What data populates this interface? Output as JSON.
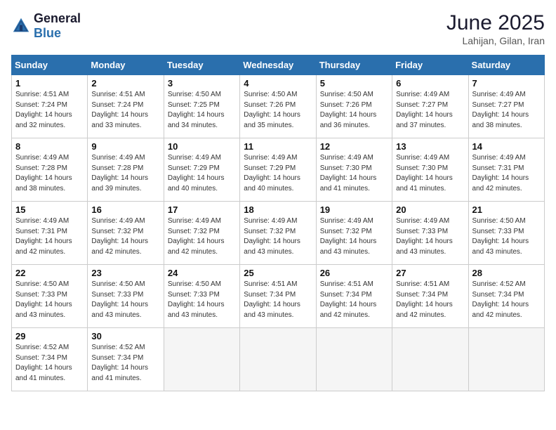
{
  "header": {
    "logo_general": "General",
    "logo_blue": "Blue",
    "title": "June 2025",
    "subtitle": "Lahijan, Gilan, Iran"
  },
  "weekdays": [
    "Sunday",
    "Monday",
    "Tuesday",
    "Wednesday",
    "Thursday",
    "Friday",
    "Saturday"
  ],
  "weeks": [
    [
      {
        "day": 1,
        "sunrise": "4:51 AM",
        "sunset": "7:24 PM",
        "daylight": "14 hours and 32 minutes."
      },
      {
        "day": 2,
        "sunrise": "4:51 AM",
        "sunset": "7:24 PM",
        "daylight": "14 hours and 33 minutes."
      },
      {
        "day": 3,
        "sunrise": "4:50 AM",
        "sunset": "7:25 PM",
        "daylight": "14 hours and 34 minutes."
      },
      {
        "day": 4,
        "sunrise": "4:50 AM",
        "sunset": "7:26 PM",
        "daylight": "14 hours and 35 minutes."
      },
      {
        "day": 5,
        "sunrise": "4:50 AM",
        "sunset": "7:26 PM",
        "daylight": "14 hours and 36 minutes."
      },
      {
        "day": 6,
        "sunrise": "4:49 AM",
        "sunset": "7:27 PM",
        "daylight": "14 hours and 37 minutes."
      },
      {
        "day": 7,
        "sunrise": "4:49 AM",
        "sunset": "7:27 PM",
        "daylight": "14 hours and 38 minutes."
      }
    ],
    [
      {
        "day": 8,
        "sunrise": "4:49 AM",
        "sunset": "7:28 PM",
        "daylight": "14 hours and 38 minutes."
      },
      {
        "day": 9,
        "sunrise": "4:49 AM",
        "sunset": "7:28 PM",
        "daylight": "14 hours and 39 minutes."
      },
      {
        "day": 10,
        "sunrise": "4:49 AM",
        "sunset": "7:29 PM",
        "daylight": "14 hours and 40 minutes."
      },
      {
        "day": 11,
        "sunrise": "4:49 AM",
        "sunset": "7:29 PM",
        "daylight": "14 hours and 40 minutes."
      },
      {
        "day": 12,
        "sunrise": "4:49 AM",
        "sunset": "7:30 PM",
        "daylight": "14 hours and 41 minutes."
      },
      {
        "day": 13,
        "sunrise": "4:49 AM",
        "sunset": "7:30 PM",
        "daylight": "14 hours and 41 minutes."
      },
      {
        "day": 14,
        "sunrise": "4:49 AM",
        "sunset": "7:31 PM",
        "daylight": "14 hours and 42 minutes."
      }
    ],
    [
      {
        "day": 15,
        "sunrise": "4:49 AM",
        "sunset": "7:31 PM",
        "daylight": "14 hours and 42 minutes."
      },
      {
        "day": 16,
        "sunrise": "4:49 AM",
        "sunset": "7:32 PM",
        "daylight": "14 hours and 42 minutes."
      },
      {
        "day": 17,
        "sunrise": "4:49 AM",
        "sunset": "7:32 PM",
        "daylight": "14 hours and 42 minutes."
      },
      {
        "day": 18,
        "sunrise": "4:49 AM",
        "sunset": "7:32 PM",
        "daylight": "14 hours and 43 minutes."
      },
      {
        "day": 19,
        "sunrise": "4:49 AM",
        "sunset": "7:32 PM",
        "daylight": "14 hours and 43 minutes."
      },
      {
        "day": 20,
        "sunrise": "4:49 AM",
        "sunset": "7:33 PM",
        "daylight": "14 hours and 43 minutes."
      },
      {
        "day": 21,
        "sunrise": "4:50 AM",
        "sunset": "7:33 PM",
        "daylight": "14 hours and 43 minutes."
      }
    ],
    [
      {
        "day": 22,
        "sunrise": "4:50 AM",
        "sunset": "7:33 PM",
        "daylight": "14 hours and 43 minutes."
      },
      {
        "day": 23,
        "sunrise": "4:50 AM",
        "sunset": "7:33 PM",
        "daylight": "14 hours and 43 minutes."
      },
      {
        "day": 24,
        "sunrise": "4:50 AM",
        "sunset": "7:33 PM",
        "daylight": "14 hours and 43 minutes."
      },
      {
        "day": 25,
        "sunrise": "4:51 AM",
        "sunset": "7:34 PM",
        "daylight": "14 hours and 43 minutes."
      },
      {
        "day": 26,
        "sunrise": "4:51 AM",
        "sunset": "7:34 PM",
        "daylight": "14 hours and 42 minutes."
      },
      {
        "day": 27,
        "sunrise": "4:51 AM",
        "sunset": "7:34 PM",
        "daylight": "14 hours and 42 minutes."
      },
      {
        "day": 28,
        "sunrise": "4:52 AM",
        "sunset": "7:34 PM",
        "daylight": "14 hours and 42 minutes."
      }
    ],
    [
      {
        "day": 29,
        "sunrise": "4:52 AM",
        "sunset": "7:34 PM",
        "daylight": "14 hours and 41 minutes."
      },
      {
        "day": 30,
        "sunrise": "4:52 AM",
        "sunset": "7:34 PM",
        "daylight": "14 hours and 41 minutes."
      },
      null,
      null,
      null,
      null,
      null
    ]
  ]
}
